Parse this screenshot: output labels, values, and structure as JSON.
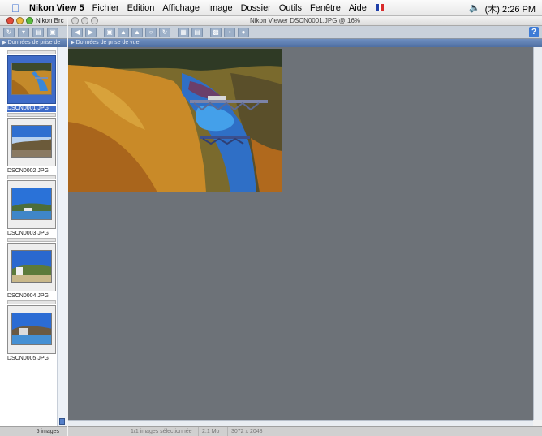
{
  "menubar": {
    "app_name": "Nikon View 5",
    "items": [
      "Fichier",
      "Edition",
      "Affichage",
      "Image",
      "Dossier",
      "Outils",
      "Fenêtre",
      "Aide"
    ],
    "clock": "(木) 2:26 PM",
    "flag_colors": [
      "#1f3fa8",
      "#ffffff",
      "#d92b2b"
    ]
  },
  "left_window": {
    "title": "Nikon Brc",
    "info_label": "Données de prise de",
    "status": "5 images"
  },
  "viewer_window": {
    "title": "Nikon Viewer DSCN0001.JPG @ 16%",
    "info_label": "Données de prise de vue",
    "help_label": "?",
    "status": {
      "selected": "1/1 images sélectionnée",
      "size": "2.1 Mo",
      "dimensions": "3072 x 2048"
    }
  },
  "thumbnails": [
    {
      "label": "DSCN0001.JPG",
      "selected": true
    },
    {
      "label": "DSCN0002.JPG",
      "selected": false
    },
    {
      "label": "DSCN0003.JPG",
      "selected": false
    },
    {
      "label": "DSCN0004.JPG",
      "selected": false
    },
    {
      "label": "DSCN0005.JPG",
      "selected": false
    }
  ],
  "colors": {
    "selection": "#3e6bc8",
    "viewer_background": "#6d7278",
    "info_header": "#5a7bb0"
  }
}
